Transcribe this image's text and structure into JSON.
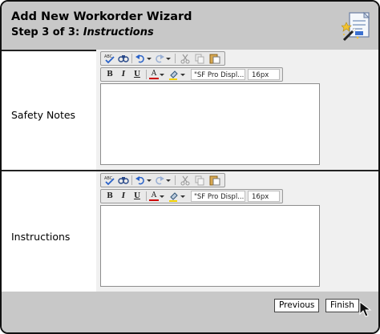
{
  "header": {
    "title": "Add New Workorder Wizard",
    "step_prefix": "Step 3 of 3: ",
    "step_name": "Instructions",
    "icon": "magic-wand-document-icon"
  },
  "fields": [
    {
      "label": "Safety Notes",
      "editor": {
        "font": "\"SF Pro Displ...",
        "size": "16px",
        "content": ""
      }
    },
    {
      "label": "Instructions",
      "editor": {
        "font": "\"SF Pro Displ...",
        "size": "16px",
        "content": ""
      }
    }
  ],
  "toolbar": {
    "spellcheck_label": "ABC",
    "bold_label": "B",
    "italic_label": "I",
    "underline_label": "U",
    "font_color_label": "A",
    "icons": [
      "spellcheck-icon",
      "find-replace-icon",
      "undo-icon",
      "redo-icon",
      "cut-icon",
      "copy-icon",
      "paste-icon",
      "highlight-icon"
    ]
  },
  "footer": {
    "previous_label": "Previous",
    "finish_label": "Finish"
  },
  "colors": {
    "header_bg": "#c8c8c8",
    "editor_panel_bg": "#f0f0f0",
    "border": "#222222"
  }
}
